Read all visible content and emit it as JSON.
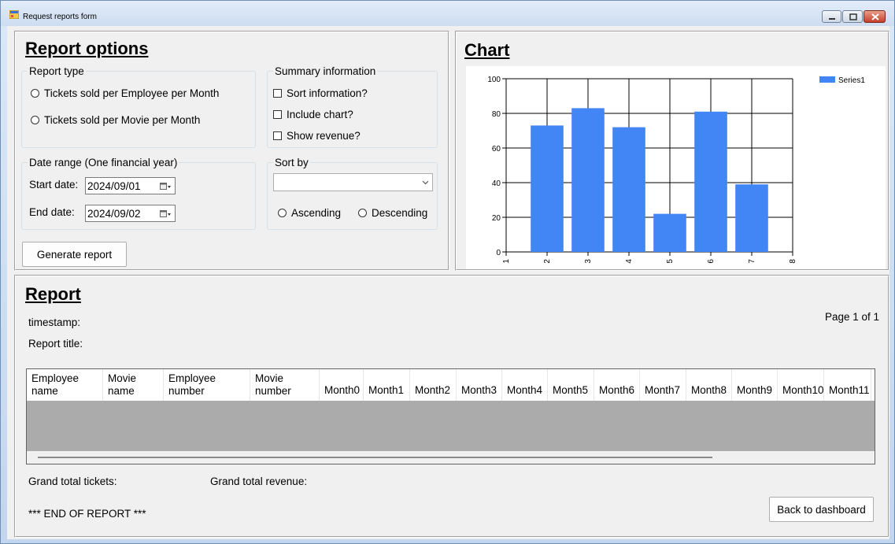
{
  "window": {
    "title": "Request reports form"
  },
  "options": {
    "heading": "Report options",
    "report_type": {
      "legend": "Report type",
      "options": [
        "Tickets sold per Employee per Month",
        "Tickets sold per Movie per Month"
      ]
    },
    "summary": {
      "legend": "Summary information",
      "checks": [
        "Sort information?",
        "Include chart?",
        "Show revenue?"
      ]
    },
    "date_range": {
      "legend": "Date range (One financial year)",
      "start_label": "Start date:",
      "start_value": "2024/09/01",
      "end_label": "End date:",
      "end_value": "2024/09/02"
    },
    "sort_by": {
      "legend": "Sort by",
      "selected": "",
      "ascending": "Ascending",
      "descending": "Descending"
    },
    "generate_label": "Generate report"
  },
  "chart": {
    "heading": "Chart",
    "legend_label": "Series1"
  },
  "chart_data": {
    "type": "bar",
    "series": [
      {
        "name": "Series1",
        "color": "#4285f4",
        "x": [
          2,
          3,
          4,
          5,
          6,
          7
        ],
        "values": [
          73,
          83,
          72,
          22,
          81,
          39
        ]
      }
    ],
    "xlim": [
      1,
      8
    ],
    "ylim": [
      0,
      100
    ],
    "xticks": [
      "1",
      "2",
      "3",
      "4",
      "5",
      "6",
      "7",
      "8"
    ],
    "yticks": [
      "0",
      "20",
      "40",
      "60",
      "80",
      "100"
    ],
    "grid": true,
    "legend_position": "top-right"
  },
  "report": {
    "heading": "Report",
    "timestamp_label": "timestamp:",
    "title_label": "Report title:",
    "page_label": "Page 1 of 1",
    "columns": [
      "Employee name",
      "Movie name",
      "Employee number",
      "Movie number",
      "Month0",
      "Month1",
      "Month2",
      "Month3",
      "Month4",
      "Month5",
      "Month6",
      "Month7",
      "Month8",
      "Month9",
      "Month10",
      "Month11"
    ],
    "grand_total_tickets": "Grand total tickets:",
    "grand_total_revenue": "Grand total revenue:",
    "end_label": "*** END OF REPORT ***",
    "back_label": "Back to dashboard"
  }
}
